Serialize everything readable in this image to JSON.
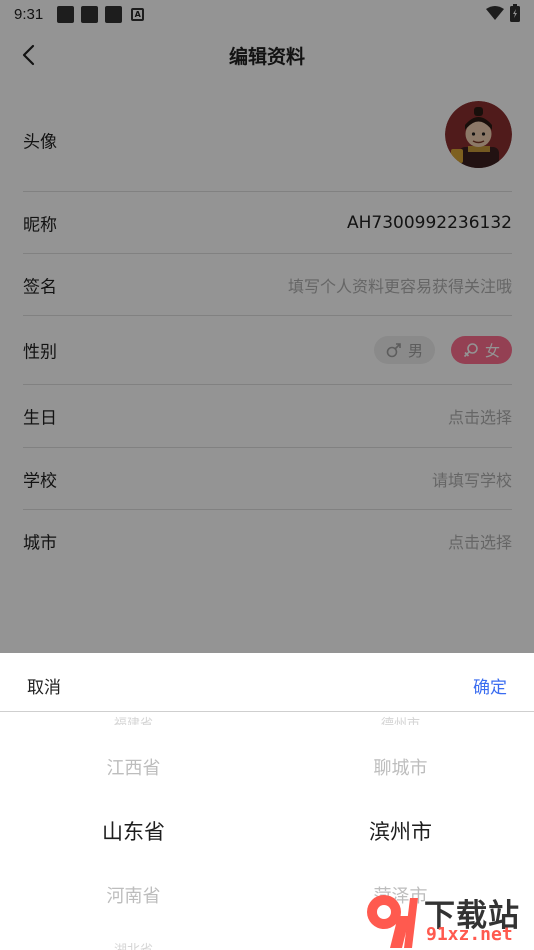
{
  "status_bar": {
    "time": "9:31",
    "notification_icon_letter": "A"
  },
  "header": {
    "title": "编辑资料"
  },
  "rows": {
    "avatar": {
      "label": "头像"
    },
    "nickname": {
      "label": "昵称",
      "value": "AH7300992236132"
    },
    "signature": {
      "label": "签名",
      "placeholder": "填写个人资料更容易获得关注哦"
    },
    "gender": {
      "label": "性别",
      "male": "男",
      "female": "女",
      "selected": "女"
    },
    "birthday": {
      "label": "生日",
      "placeholder": "点击选择"
    },
    "school": {
      "label": "学校",
      "placeholder": "请填写学校"
    },
    "city": {
      "label": "城市",
      "placeholder": "点击选择"
    }
  },
  "picker": {
    "cancel": "取消",
    "confirm": "确定",
    "province": {
      "prev_faint": "福建省",
      "prev": "江西省",
      "selected": "山东省",
      "next": "河南省",
      "next_faint": "湖北省"
    },
    "city": {
      "prev_faint": "德州市",
      "prev": "聊城市",
      "selected": "滨州市",
      "next": "菏泽市"
    }
  },
  "watermark": {
    "brand": "下载站",
    "url": "91xz.net"
  },
  "colors": {
    "accent_blue": "#3a6cf0",
    "female_pink": "#ff6f8f",
    "overlay": "rgba(0,0,0,0.42)"
  }
}
